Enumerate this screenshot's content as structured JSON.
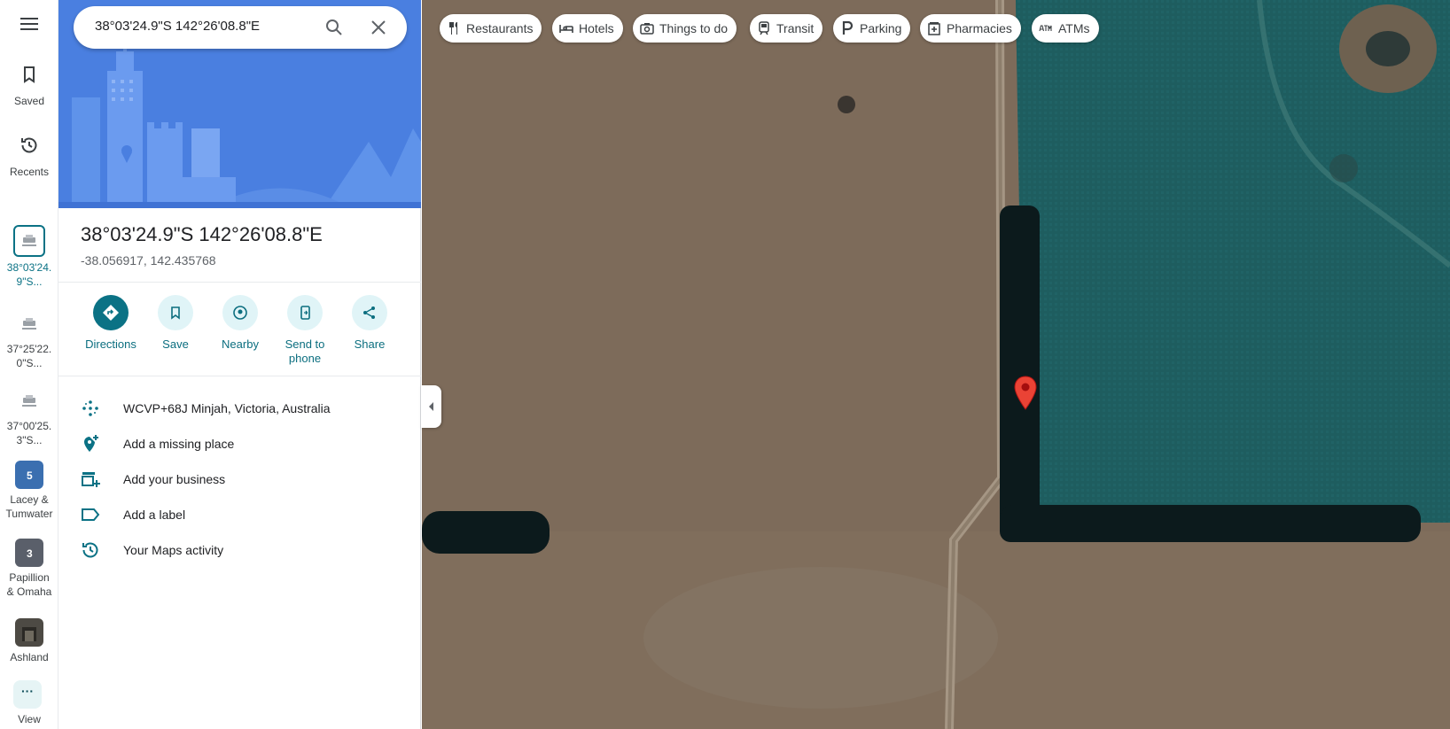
{
  "rail": {
    "saved": "Saved",
    "recents": "Recents",
    "recent_items": [
      {
        "label_line1": "38°03'24.",
        "label_line2": "9\"S..."
      },
      {
        "label_line1": "37°25'22.",
        "label_line2": "0\"S..."
      },
      {
        "label_line1": "37°00'25.",
        "label_line2": "3\"S..."
      },
      {
        "label_line1": "Lacey &",
        "label_line2": "Tumwater",
        "badge": "5"
      },
      {
        "label_line1": "Papillion",
        "label_line2": "& Omaha",
        "badge": "3"
      },
      {
        "label_line1": "Ashland",
        "label_line2": ""
      }
    ],
    "view": "View"
  },
  "search": {
    "value": "38°03'24.9\"S 142°26'08.8\"E"
  },
  "place": {
    "title": "38°03'24.9\"S 142°26'08.8\"E",
    "coords": "-38.056917, 142.435768"
  },
  "actions": {
    "directions": "Directions",
    "save": "Save",
    "nearby": "Nearby",
    "send_line1": "Send to",
    "send_line2": "phone",
    "share": "Share"
  },
  "rows": {
    "plus_code": "WCVP+68J Minjah, Victoria, Australia",
    "missing_place": "Add a missing place",
    "business": "Add your business",
    "label": "Add a label",
    "activity": "Your Maps activity"
  },
  "chips": {
    "restaurants": "Restaurants",
    "hotels": "Hotels",
    "things": "Things to do",
    "transit": "Transit",
    "parking": "Parking",
    "pharmacies": "Pharmacies",
    "atms": "ATMs"
  },
  "colors": {
    "accent": "#0b7285",
    "marker": "#ea4335",
    "field": "#7d6b5a",
    "crop": "#1e5a5c"
  }
}
